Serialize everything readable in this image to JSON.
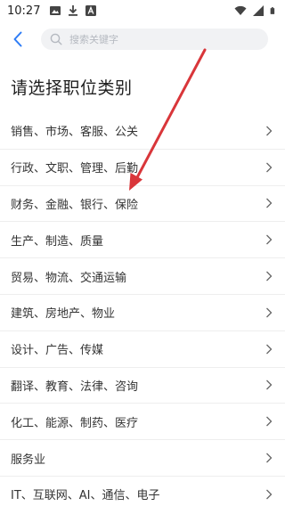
{
  "status_bar": {
    "time": "10:27"
  },
  "search": {
    "placeholder": "搜索关键字",
    "value": ""
  },
  "page": {
    "title": "请选择职位类别"
  },
  "categories": [
    {
      "label": "销售、市场、客服、公关"
    },
    {
      "label": "行政、文职、管理、后勤"
    },
    {
      "label": "财务、金融、银行、保险"
    },
    {
      "label": "生产、制造、质量"
    },
    {
      "label": "贸易、物流、交通运输"
    },
    {
      "label": "建筑、房地产、物业"
    },
    {
      "label": "设计、广告、传媒"
    },
    {
      "label": "翻译、教育、法律、咨询"
    },
    {
      "label": "化工、能源、制药、医疗"
    },
    {
      "label": "服务业"
    },
    {
      "label": "IT、互联网、AI、通信、电子"
    }
  ],
  "colors": {
    "accent": "#2e7cf6",
    "annotation": "#d9363a",
    "divider": "#eeeeee",
    "search_bg": "#f1f2f4"
  },
  "icons": {
    "back": "chevron-left-icon",
    "search": "search-icon",
    "row": "chevron-right-icon",
    "status": [
      "image-icon",
      "download-icon",
      "font-icon",
      "wifi-icon",
      "signal-icon",
      "battery-icon"
    ]
  }
}
